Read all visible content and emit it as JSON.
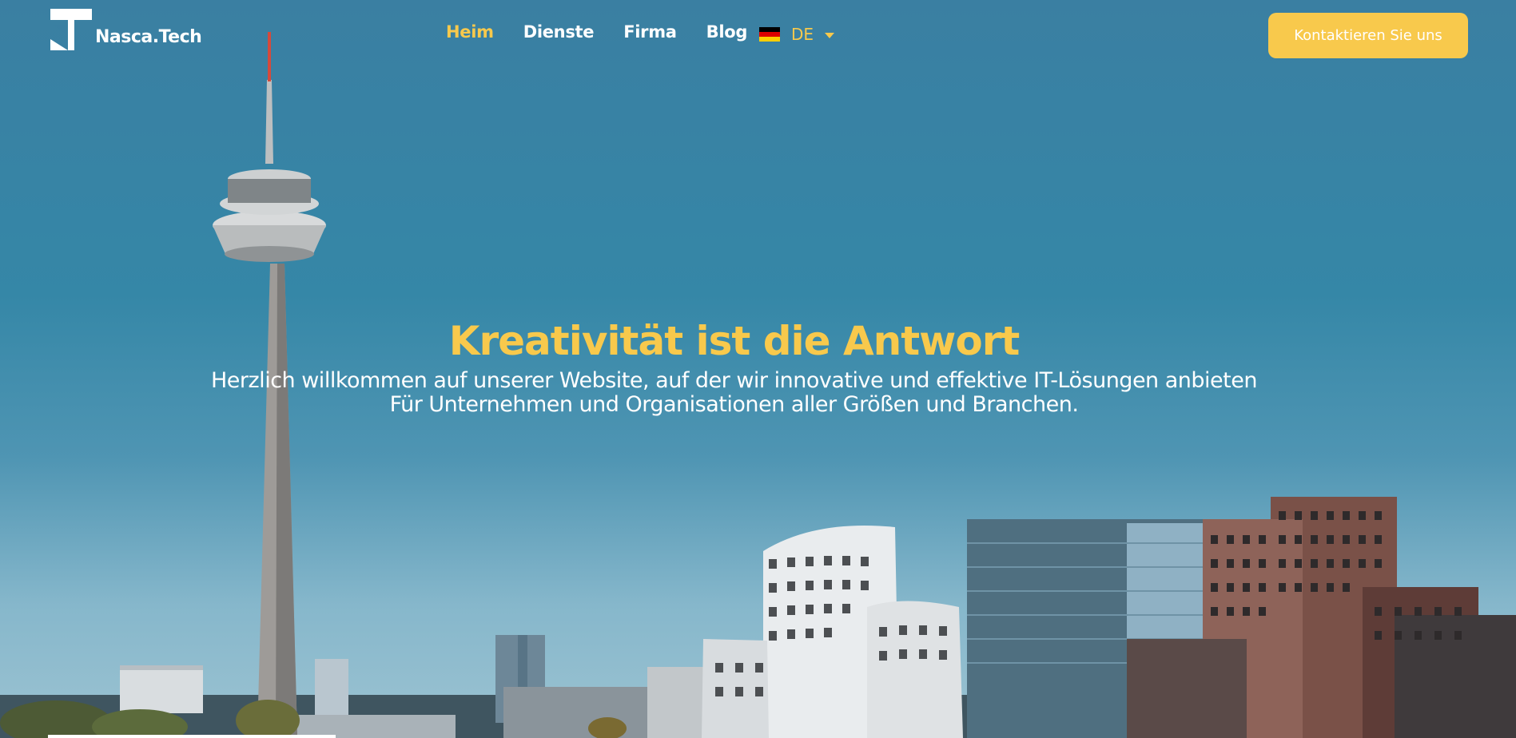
{
  "brand": {
    "name": "Nasca.Tech"
  },
  "nav": {
    "items": [
      {
        "label": "Heim",
        "active": true
      },
      {
        "label": "Dienste",
        "active": false
      },
      {
        "label": "Firma",
        "active": false
      },
      {
        "label": "Blog",
        "active": false
      }
    ]
  },
  "language": {
    "code": "DE",
    "flag_icon": "germany-flag-icon"
  },
  "cta": {
    "label": "Kontaktieren Sie uns"
  },
  "hero": {
    "headline": "Kreativität ist die Antwort",
    "tagline_line1": "Herzlich willkommen auf unserer Website, auf der wir innovative und effektive IT-Lösungen anbieten",
    "tagline_line2": "Für Unternehmen und Organisationen aller Größen und Branchen."
  },
  "colors": {
    "accent": "#f8c94c",
    "text": "#ffffff",
    "sky": "#3a7fa2"
  }
}
